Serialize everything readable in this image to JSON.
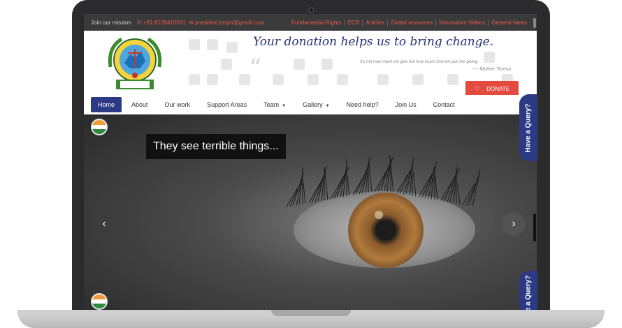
{
  "topbar": {
    "mission": "Join our mission",
    "phone": "+91-8108410031",
    "email": "president.hrsjm@gmail.com",
    "links": [
      "Fundamental Rights",
      "ECR",
      "Articles",
      "Global resources",
      "Informative Videos",
      "General News"
    ]
  },
  "header": {
    "tagline": "Your donation helps us to bring change.",
    "quote": "It's not how much we give but how much love we put into giving.",
    "quote_author": "---- Mother Teresa",
    "donate_label": "DONATE"
  },
  "nav": {
    "items": [
      {
        "label": "Home",
        "active": true,
        "dropdown": false
      },
      {
        "label": "About",
        "active": false,
        "dropdown": false
      },
      {
        "label": "Our work",
        "active": false,
        "dropdown": false
      },
      {
        "label": "Support Areas",
        "active": false,
        "dropdown": false
      },
      {
        "label": "Team",
        "active": false,
        "dropdown": true
      },
      {
        "label": "Gallery",
        "active": false,
        "dropdown": true
      },
      {
        "label": "Need help?",
        "active": false,
        "dropdown": false
      },
      {
        "label": "Join Us",
        "active": false,
        "dropdown": false
      },
      {
        "label": "Contact",
        "active": false,
        "dropdown": false
      }
    ]
  },
  "hero": {
    "caption": "They see terrible things...",
    "prev_icon": "chevron-left-icon",
    "next_icon": "chevron-right-icon"
  },
  "query_tab_label": "Have a Query?",
  "colors": {
    "brand_blue": "#2c3a86",
    "accent_red": "#e34b3f",
    "topbar_bg": "#3a3a3a"
  }
}
